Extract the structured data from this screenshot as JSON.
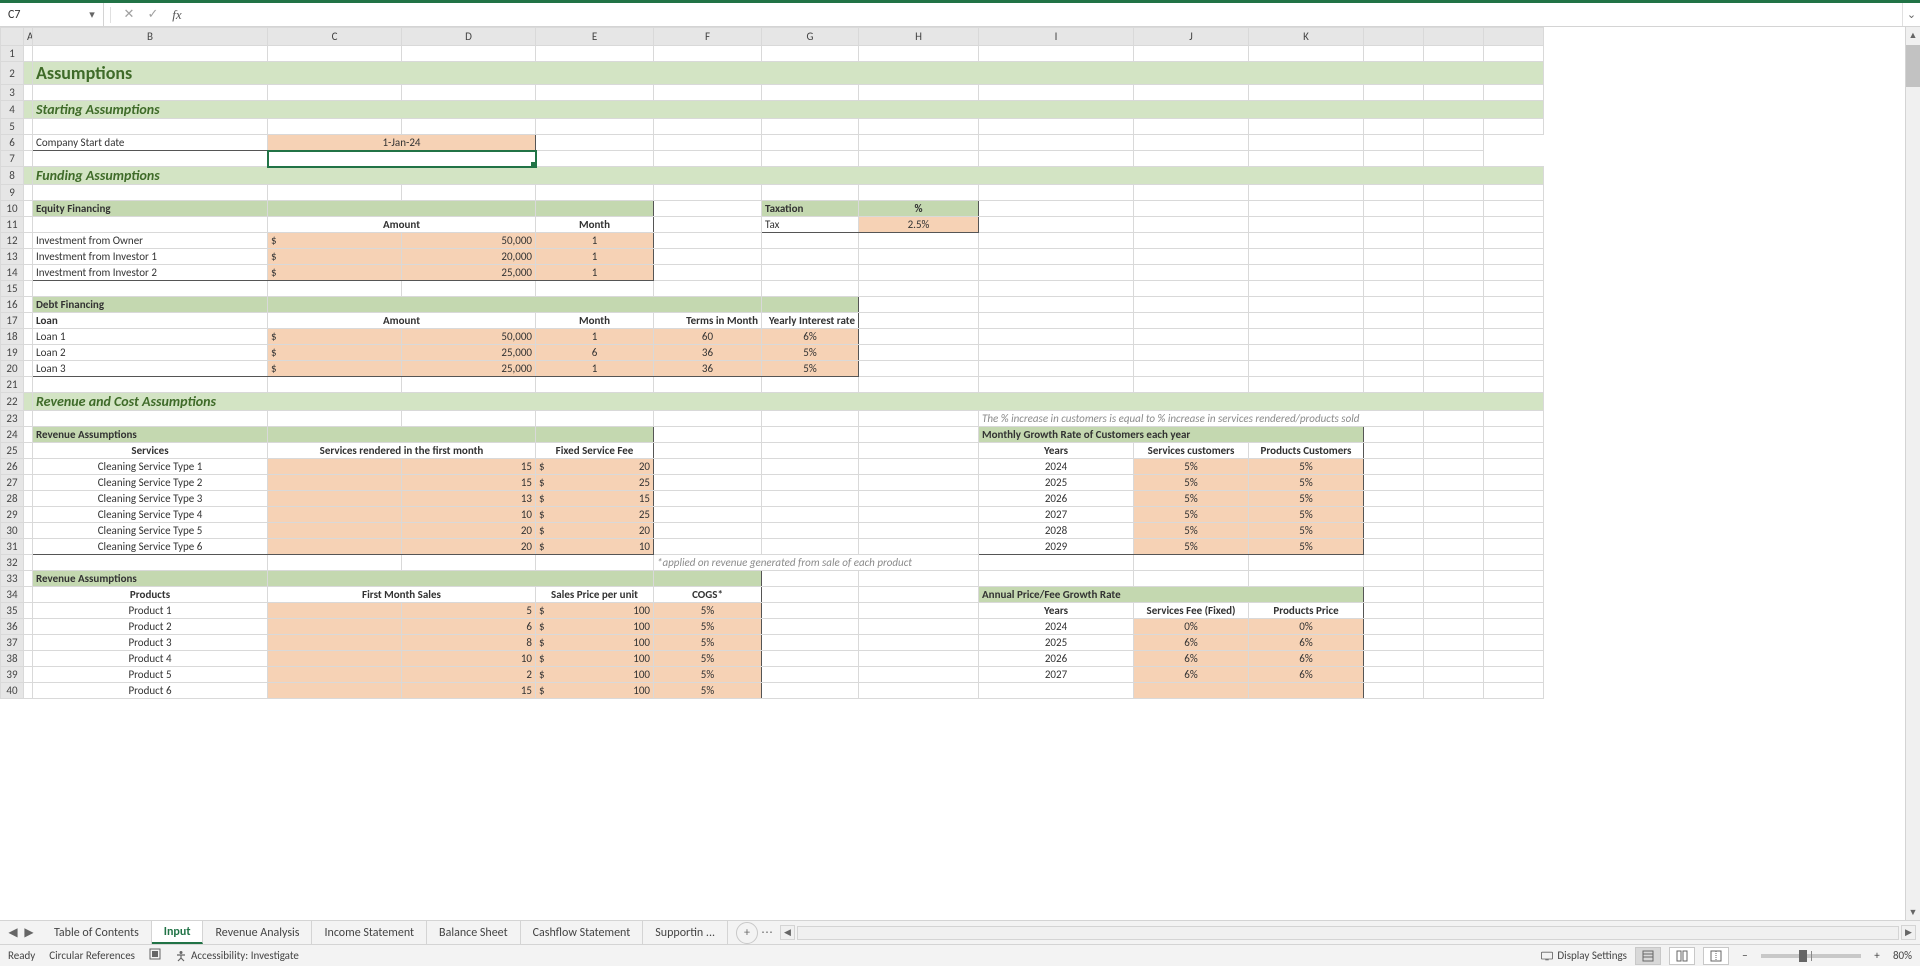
{
  "name_box": "C7",
  "formula": "",
  "columns": [
    "A",
    "B",
    "C",
    "D",
    "E",
    "F",
    "G",
    "H",
    "I",
    "J",
    "K"
  ],
  "rows": {
    "1": [
      "",
      "",
      "",
      "",
      "",
      "",
      "",
      "",
      "",
      "",
      ""
    ],
    "2": [
      "",
      "Assumptions",
      "",
      "",
      "",
      "",
      "",
      "",
      "",
      "",
      ""
    ],
    "3": [
      "",
      "",
      "",
      "",
      "",
      "",
      "",
      "",
      "",
      "",
      ""
    ],
    "4": [
      "",
      "Starting Assumptions",
      "",
      "",
      "",
      "",
      "",
      "",
      "",
      "",
      ""
    ],
    "5": [
      "",
      "",
      "",
      "",
      "",
      "",
      "",
      "",
      "",
      "",
      ""
    ],
    "6": [
      "",
      "Company Start date",
      "1-Jan-24",
      "",
      "",
      "",
      "",
      "",
      "",
      "",
      ""
    ],
    "7": [
      "",
      "",
      "",
      "",
      "",
      "",
      "",
      "",
      "",
      "",
      ""
    ],
    "8": [
      "",
      "Funding Assumptions",
      "",
      "",
      "",
      "",
      "",
      "",
      "",
      "",
      ""
    ],
    "9": [
      "",
      "",
      "",
      "",
      "",
      "",
      "",
      "",
      "",
      "",
      ""
    ],
    "10": [
      "",
      "Equity Financing",
      "",
      "",
      "",
      "",
      "Taxation",
      "%",
      "",
      "",
      ""
    ],
    "11": [
      "",
      "",
      "Amount",
      "Month",
      "",
      "",
      "Tax",
      "2.5%",
      "",
      "",
      ""
    ],
    "12": [
      "",
      "Investment from Owner",
      "$",
      "50,000",
      "1",
      "",
      "",
      "",
      "",
      "",
      ""
    ],
    "13": [
      "",
      "Investment from Investor 1",
      "$",
      "20,000",
      "1",
      "",
      "",
      "",
      "",
      "",
      ""
    ],
    "14": [
      "",
      "Investment from Investor 2",
      "$",
      "25,000",
      "1",
      "",
      "",
      "",
      "",
      "",
      ""
    ],
    "15": [
      "",
      "",
      "",
      "",
      "",
      "",
      "",
      "",
      "",
      "",
      ""
    ],
    "16": [
      "",
      "Debt Financing",
      "",
      "",
      "",
      "",
      "",
      "",
      "",
      "",
      ""
    ],
    "17": [
      "",
      "Loan",
      "Amount",
      "Month",
      "Terms in Month",
      "Yearly Interest rate",
      "",
      "",
      "",
      "",
      ""
    ],
    "18": [
      "",
      "Loan 1",
      "$",
      "50,000",
      "1",
      "60",
      "6%",
      "",
      "",
      "",
      ""
    ],
    "19": [
      "",
      "Loan 2",
      "$",
      "25,000",
      "6",
      "36",
      "5%",
      "",
      "",
      "",
      ""
    ],
    "20": [
      "",
      "Loan 3",
      "$",
      "25,000",
      "1",
      "36",
      "5%",
      "",
      "",
      "",
      ""
    ],
    "21": [
      "",
      "",
      "",
      "",
      "",
      "",
      "",
      "",
      "",
      "",
      ""
    ],
    "22": [
      "",
      "Revenue and Cost Assumptions",
      "",
      "",
      "",
      "",
      "",
      "",
      "",
      "",
      ""
    ],
    "23": [
      "",
      "",
      "",
      "",
      "",
      "",
      "",
      "",
      "The % increase in customers is equal to % increase in services rendered/products sold",
      "",
      ""
    ],
    "24": [
      "",
      "Revenue Assumptions",
      "",
      "",
      "",
      "",
      "",
      "",
      "Monthly Growth Rate of Customers each year",
      "",
      ""
    ],
    "25": [
      "",
      "Services",
      "Services rendered in the first month",
      "",
      "Fixed Service Fee",
      "",
      "",
      "",
      "Years",
      "Services customers",
      "Products Customers"
    ],
    "26": [
      "",
      "Cleaning Service Type 1",
      "",
      "15",
      "$",
      "20",
      "",
      "",
      "2024",
      "5%",
      "5%"
    ],
    "27": [
      "",
      "Cleaning Service Type 2",
      "",
      "15",
      "$",
      "25",
      "",
      "",
      "2025",
      "5%",
      "5%"
    ],
    "28": [
      "",
      "Cleaning Service Type 3",
      "",
      "13",
      "$",
      "15",
      "",
      "",
      "2026",
      "5%",
      "5%"
    ],
    "29": [
      "",
      "Cleaning Service Type 4",
      "",
      "10",
      "$",
      "25",
      "",
      "",
      "2027",
      "5%",
      "5%"
    ],
    "30": [
      "",
      "Cleaning Service Type 5",
      "",
      "20",
      "$",
      "20",
      "",
      "",
      "2028",
      "5%",
      "5%"
    ],
    "31": [
      "",
      "Cleaning Service Type 6",
      "",
      "20",
      "$",
      "10",
      "",
      "",
      "2029",
      "5%",
      "5%"
    ],
    "32": [
      "",
      "",
      "",
      "",
      "",
      "*applied on revenue generated from sale of each product",
      "",
      "",
      "",
      "",
      ""
    ],
    "33": [
      "",
      "Revenue Assumptions",
      "",
      "",
      "",
      "",
      "",
      "",
      "",
      "",
      ""
    ],
    "34": [
      "",
      "Products",
      "First Month Sales",
      "",
      "Sales Price per unit",
      "COGS*",
      "",
      "",
      "Annual Price/Fee Growth Rate",
      "",
      ""
    ],
    "35": [
      "",
      "Product 1",
      "",
      "5",
      "$",
      "100",
      "5%",
      "",
      "Years",
      "Services Fee (Fixed)",
      "Products Price"
    ],
    "36": [
      "",
      "Product 2",
      "",
      "6",
      "$",
      "100",
      "5%",
      "",
      "2024",
      "0%",
      "0%"
    ],
    "37": [
      "",
      "Product 3",
      "",
      "8",
      "$",
      "100",
      "5%",
      "",
      "2025",
      "6%",
      "6%"
    ],
    "38": [
      "",
      "Product 4",
      "",
      "10",
      "$",
      "100",
      "5%",
      "",
      "2026",
      "6%",
      "6%"
    ],
    "39": [
      "",
      "Product 5",
      "",
      "2",
      "$",
      "100",
      "5%",
      "",
      "2027",
      "6%",
      "6%"
    ],
    "40": [
      "",
      "Product 6",
      "",
      "15",
      "$",
      "100",
      "5%",
      "",
      "",
      "",
      ""
    ]
  },
  "tabs": [
    "Table of Contents",
    "Input",
    "Revenue Analysis",
    "Income Statement",
    "Balance Sheet",
    "Cashflow Statement",
    "Supportin ..."
  ],
  "active_tab": 1,
  "status": {
    "ready": "Ready",
    "circular": "Circular References",
    "accessibility": "Accessibility: Investigate",
    "display": "Display Settings",
    "zoom": "80%"
  }
}
